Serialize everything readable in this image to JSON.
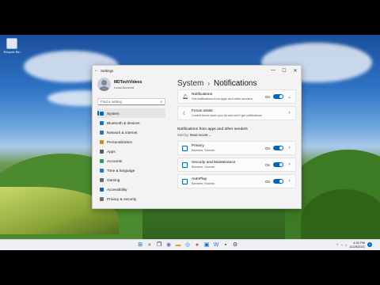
{
  "desktop": {
    "recycle_bin_label": "Recycle Bin"
  },
  "window": {
    "title": "Settings",
    "controls": {
      "minimize": "—",
      "maximize": "☐",
      "close": "✕"
    },
    "back_icon": "back-arrow-icon"
  },
  "profile": {
    "name": "MDTechVideos",
    "account_type": "Local Account"
  },
  "search": {
    "placeholder": "Find a setting",
    "value": ""
  },
  "nav": [
    {
      "label": "System",
      "icon": "system-icon",
      "color": "#0067c0",
      "active": true
    },
    {
      "label": "Bluetooth & devices",
      "icon": "bluetooth-icon",
      "color": "#1a73c9"
    },
    {
      "label": "Network & internet",
      "icon": "network-icon",
      "color": "#3a6ea5"
    },
    {
      "label": "Personalization",
      "icon": "brush-icon",
      "color": "#c98a2b"
    },
    {
      "label": "Apps",
      "icon": "apps-icon",
      "color": "#555b66"
    },
    {
      "label": "Accounts",
      "icon": "accounts-icon",
      "color": "#2e9b5b"
    },
    {
      "label": "Time & language",
      "icon": "globe-icon",
      "color": "#1f7acb"
    },
    {
      "label": "Gaming",
      "icon": "gaming-icon",
      "color": "#666a70"
    },
    {
      "label": "Accessibility",
      "icon": "accessibility-icon",
      "color": "#1a5fa8"
    },
    {
      "label": "Privacy & security",
      "icon": "shield-icon",
      "color": "#6b6f76"
    }
  ],
  "main": {
    "breadcrumb_parent": "System",
    "breadcrumb_separator": "›",
    "breadcrumb_current": "Notifications",
    "notifications_card": {
      "title": "Notifications",
      "subtitle": "Get notifications from apps and other senders",
      "state": "On",
      "expander": "⌄"
    },
    "focus_card": {
      "title": "Focus assist",
      "subtitle": "Control times when you do and don't get notifications"
    },
    "section_title": "Notifications from apps and other senders",
    "sort_label": "Sort by:",
    "sort_value": "Most recent",
    "apps": [
      {
        "name": "Privacy",
        "detail": "Banners, Sounds",
        "state": "On"
      },
      {
        "name": "Security and Maintenance",
        "detail": "Banners, Sounds",
        "state": "On"
      },
      {
        "name": "AutoPlay",
        "detail": "Banners, Sounds",
        "state": "On"
      }
    ]
  },
  "taskbar": {
    "tray_caret": "^",
    "time": "4:30 PM",
    "date": "11/28/2021",
    "notification_count": "1"
  }
}
